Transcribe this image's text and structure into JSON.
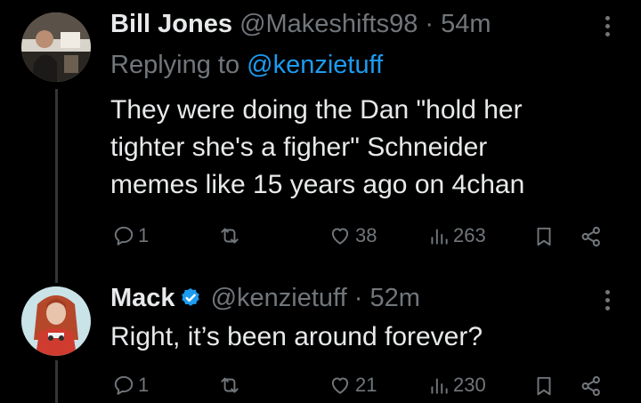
{
  "tweets": [
    {
      "name": "Bill Jones",
      "handle": "@Makeshifts98",
      "time": "54m",
      "replying_prefix": "Replying to ",
      "replying_to": "@kenzietuff",
      "text_lines": [
        "They were doing the Dan \"hold her",
        "tighter she's a figher\" Schneider",
        "memes like 15 years ago on 4chan"
      ],
      "replies": "1",
      "retweets": "",
      "likes": "38",
      "views": "263"
    },
    {
      "name": "Mack",
      "verified": true,
      "handle": "@kenzietuff",
      "time": "52m",
      "text_lines": [
        "Right, it’s been around forever?"
      ],
      "replies": "1",
      "retweets": "",
      "likes": "21",
      "views": "230"
    }
  ],
  "separator": "·",
  "icons": [
    "reply-icon",
    "retweet-icon",
    "like-icon",
    "views-icon",
    "bookmark-icon",
    "share-icon",
    "more-icon",
    "verified-icon"
  ],
  "colors": {
    "background": "#000000",
    "text": "#e7e9ea",
    "muted": "#71767b",
    "accent": "#1d9bf0"
  }
}
